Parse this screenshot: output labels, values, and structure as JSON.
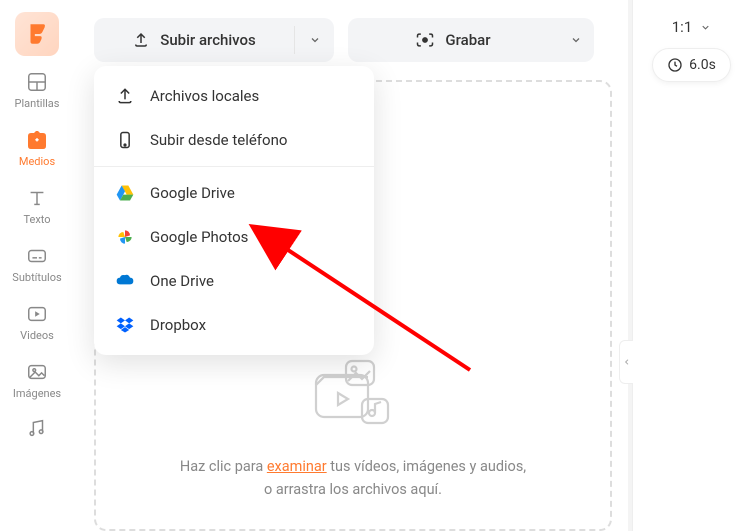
{
  "sidebar": {
    "items": [
      {
        "label": "Plantillas"
      },
      {
        "label": "Medios"
      },
      {
        "label": "Texto"
      },
      {
        "label": "Subtítulos"
      },
      {
        "label": "Videos"
      },
      {
        "label": "Imágenes"
      }
    ]
  },
  "toolbar": {
    "upload_label": "Subir archivos",
    "record_label": "Grabar"
  },
  "dropdown": {
    "items": [
      {
        "label": "Archivos locales"
      },
      {
        "label": "Subir desde teléfono"
      },
      {
        "label": "Google Drive"
      },
      {
        "label": "Google Photos"
      },
      {
        "label": "One Drive"
      },
      {
        "label": "Dropbox"
      }
    ]
  },
  "dropzone": {
    "line1_pre": "Haz clic para ",
    "browse": "examinar",
    "line1_post": " tus vídeos, imágenes y audios,",
    "line2": "o arrastra los archivos aquí."
  },
  "right": {
    "ratio": "1:1",
    "duration": "6.0s"
  }
}
